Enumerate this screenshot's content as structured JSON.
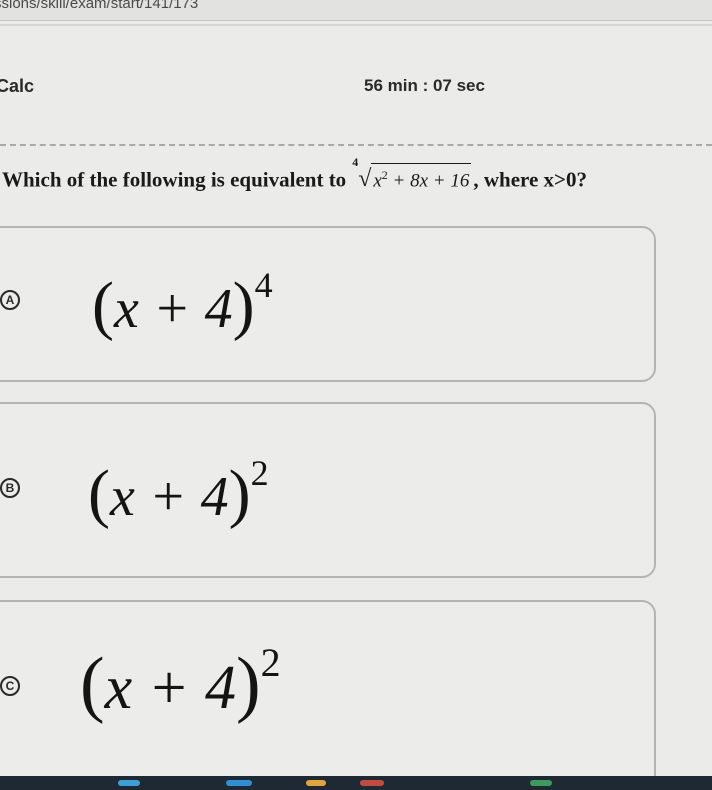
{
  "browser": {
    "url": "ssions/skill/exam/start/141/173"
  },
  "header": {
    "calc_label": "Calc",
    "timer": "56 min : 07 sec"
  },
  "question": {
    "prefix": "Which of the following is equivalent to",
    "root_index": "4",
    "radicand_x": "x",
    "radicand_exp": "2",
    "radicand_rest": " + 8x + 16",
    "suffix": ", where x>0?"
  },
  "options": [
    {
      "letter": "A",
      "base": "x + 4",
      "exponent": "4"
    },
    {
      "letter": "B",
      "base": "x + 4",
      "exponent": "2"
    },
    {
      "letter": "C",
      "base": "x + 4",
      "exponent": "2"
    }
  ],
  "colors": {
    "background": "#ebebea",
    "option_border": "#b4b4b1",
    "text": "#1c1c1c",
    "taskbar": "#1f2933"
  }
}
